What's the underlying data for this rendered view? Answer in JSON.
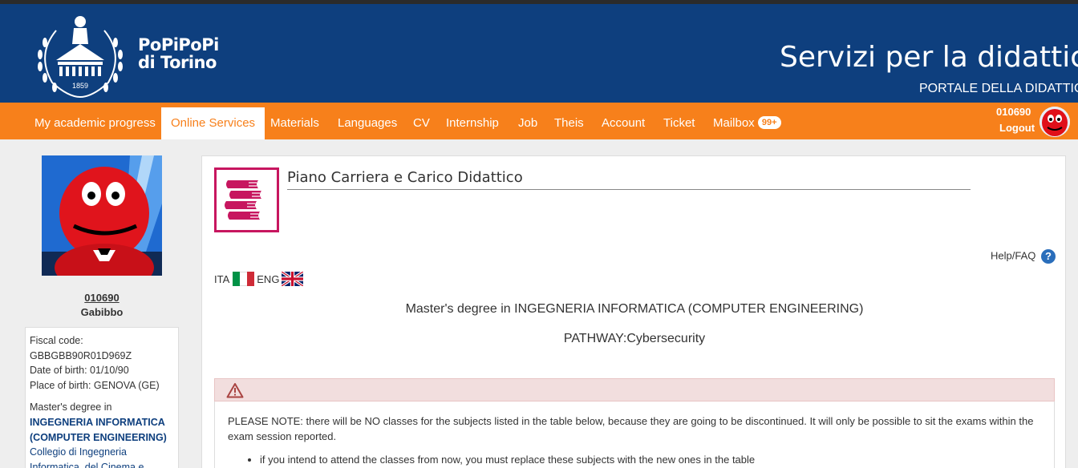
{
  "header": {
    "logo_name_line1": "PoPiPoPi",
    "logo_name_line2": "di Torino",
    "logo_year": "1859",
    "site_title": "Servizi per la didattica",
    "site_subtitle": "PORTALE DELLA DIDATTICA"
  },
  "nav": {
    "items": [
      {
        "label": "My academic progress"
      },
      {
        "label": "Online Services"
      },
      {
        "label": "Materials"
      },
      {
        "label": "Languages"
      },
      {
        "label": "CV"
      },
      {
        "label": "Internship"
      },
      {
        "label": "Job"
      },
      {
        "label": "Theis"
      },
      {
        "label": "Account"
      },
      {
        "label": "Ticket"
      },
      {
        "label": "Mailbox"
      }
    ],
    "active_item": "Online Services",
    "mailbox_badge": "99+",
    "user_code": "010690",
    "logout_label": "Logout"
  },
  "profile": {
    "code": "010690",
    "name": "Gabibbo",
    "fiscal_code_label": "Fiscal code:",
    "fiscal_code": "GBBGBB90R01D969Z",
    "dob_line": "Date of birth: 01/10/90",
    "pob_line": "Place of birth: GENOVA (GE)",
    "degree_type": "Master's degree in",
    "degree_name_1": "INGEGNERIA INFORMATICA",
    "degree_name_2": "(COMPUTER ENGINEERING)",
    "college_1": "Collegio di Ingegneria",
    "college_2": "Informatica, del Cinema e"
  },
  "main": {
    "title": "Piano Carriera e Carico Didattico",
    "help_label": "Help/FAQ",
    "help_icon_glyph": "?",
    "lang_ita": "ITA",
    "lang_eng": "ENG",
    "degree_line": "Master's degree in INGEGNERIA INFORMATICA (COMPUTER ENGINEERING)",
    "pathway_line": "PATHWAY:Cybersecurity",
    "notice_text": "PLEASE NOTE: there will be NO classes for the subjects listed in the table below, because they are going to be discontinued. It will only be possible to sit the exams within the exam session reported.",
    "notice_bullet_1": "if you intend to attend the classes from now, you must replace these subjects with the new ones in the table"
  },
  "colors": {
    "header_blue": "#0e3f7e",
    "nav_orange": "#f7801b",
    "icon_pink": "#c7165f",
    "alert_bg": "#f2dede",
    "alert_red": "#a94442"
  },
  "icons": [
    "wreath-logo-icon",
    "books-icon",
    "help-icon",
    "warning-icon",
    "flag-italy-icon",
    "flag-uk-icon",
    "user-avatar"
  ]
}
